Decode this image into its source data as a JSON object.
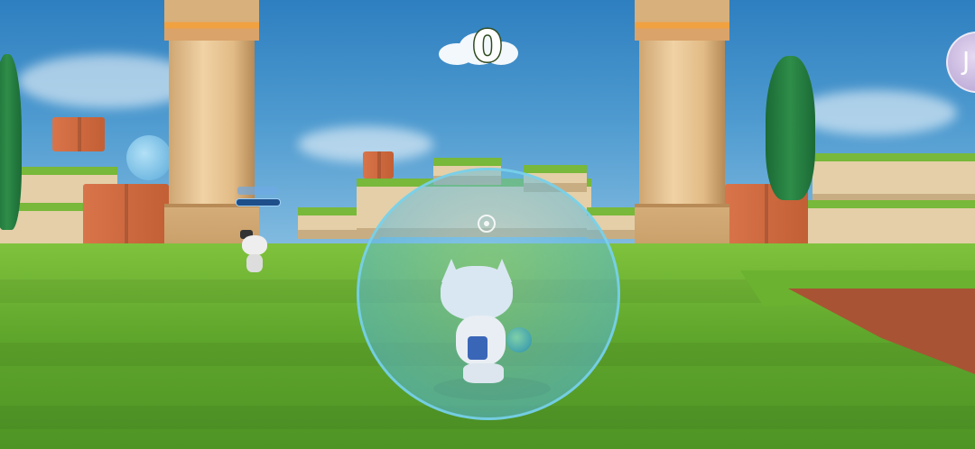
{
  "hud": {
    "score": "0",
    "join_button_label": "J"
  },
  "scene": {
    "player_skin": "astronaut-cat",
    "player_shield": "bubble-shield",
    "ally_character": "top-hat-cat"
  },
  "colors": {
    "sky": "#4f9bd0",
    "grass": "#6bb230",
    "shield": "#5ab9dc",
    "score_outline": "#2f4a1e"
  }
}
